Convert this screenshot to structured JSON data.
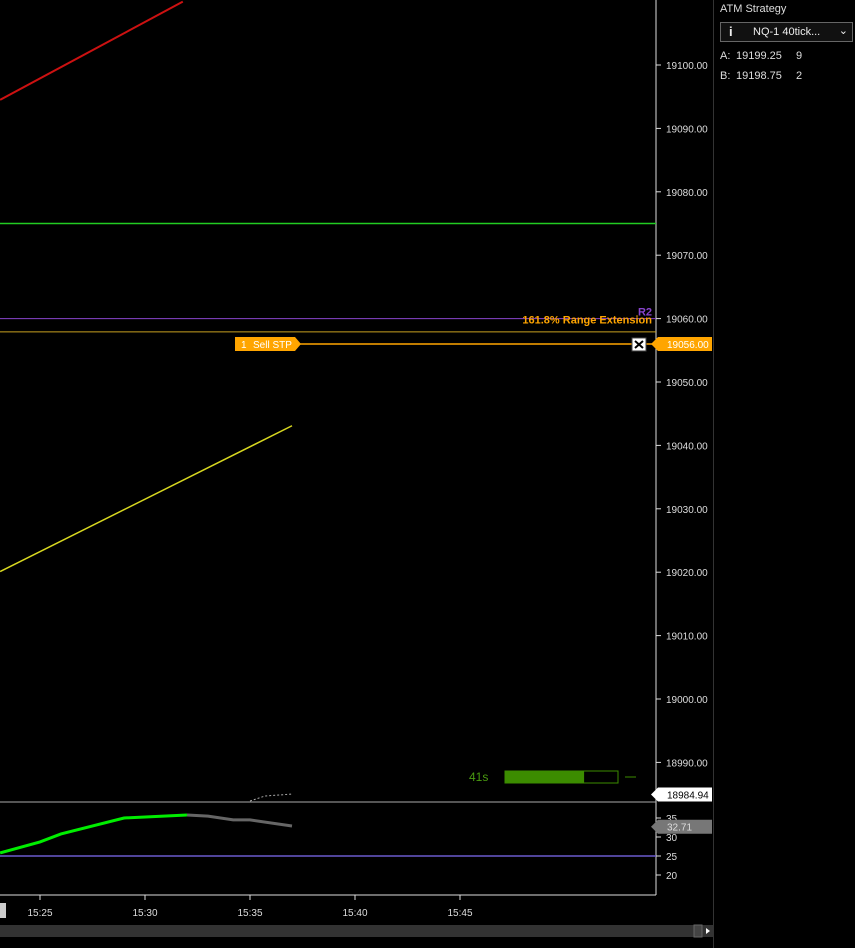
{
  "price_axis": {
    "ticks": [
      19100,
      19090,
      19080,
      19070,
      19060,
      19050,
      19040,
      19030,
      19020,
      19010,
      19000,
      18990
    ],
    "last_price": "18984.94"
  },
  "indicator_axis": {
    "ticks": [
      35,
      30,
      25,
      20
    ],
    "current": "32.71",
    "level_line": 25
  },
  "time_axis": {
    "ticks": [
      "15:25",
      "15:30",
      "15:35",
      "15:40",
      "15:45"
    ]
  },
  "levels": {
    "green": 19075,
    "r2": 19060,
    "range_ext": 19058.7
  },
  "labels": {
    "r2": "R2",
    "range_ext": "161.8% Range Extension"
  },
  "order": {
    "qty": "1",
    "type": "Sell STP",
    "price": "19056.00",
    "value": 19056
  },
  "timer": {
    "text": "41s",
    "progress": 0.7
  },
  "series": {
    "red": [
      [
        "15:23.1",
        19094.5
      ],
      [
        "15:31.8",
        19110
      ]
    ],
    "yellow": [
      [
        "15:23.1",
        19020.1
      ],
      [
        "15:37",
        19043.1
      ]
    ],
    "ind_green": [
      [
        "15:23.1",
        25.8
      ],
      [
        "15:25",
        28.7
      ],
      [
        "15:26",
        30.8
      ],
      [
        "15:29",
        35
      ],
      [
        "15:32",
        35.8
      ]
    ],
    "ind_gray": [
      [
        "15:32",
        35.8
      ],
      [
        "15:33",
        35.5
      ],
      [
        "15:34.2",
        34.5
      ],
      [
        "15:35",
        34.5
      ],
      [
        "15:37",
        32.9
      ]
    ]
  },
  "colors": {
    "red": "#cc1111",
    "yellow": "#d8d820",
    "green": "#22cc22",
    "order": "#ffa500",
    "purple": "#8844cc",
    "ind_green": "#00ee00",
    "ind_gray": "#666666",
    "level": "#6a5acd"
  },
  "side": {
    "title": "ATM Strategy",
    "strategy": "NQ-1 40tick...",
    "ask_label": "A:",
    "ask_price": "19199.25",
    "ask_size": "9",
    "bid_label": "B:",
    "bid_price": "19198.75",
    "bid_size": "2"
  }
}
